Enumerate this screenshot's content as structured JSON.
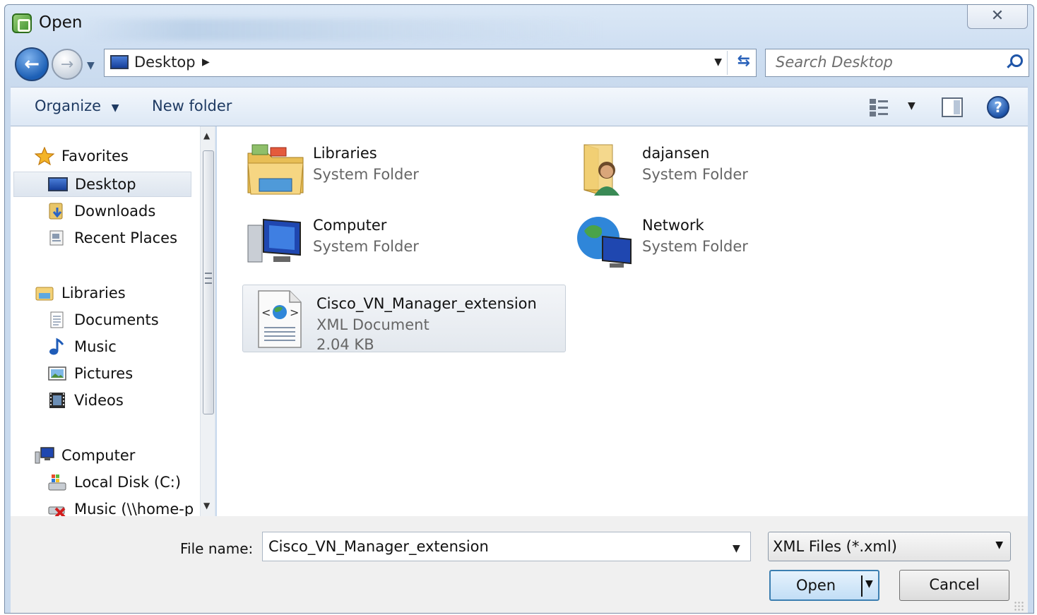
{
  "window": {
    "title": "Open"
  },
  "address": {
    "location": "Desktop"
  },
  "search": {
    "placeholder": "Search Desktop"
  },
  "toolbar": {
    "organize_label": "Organize",
    "new_folder_label": "New folder"
  },
  "sidebar": {
    "favorites": {
      "label": "Favorites",
      "items": [
        {
          "label": "Desktop"
        },
        {
          "label": "Downloads"
        },
        {
          "label": "Recent Places"
        }
      ]
    },
    "libraries": {
      "label": "Libraries",
      "items": [
        {
          "label": "Documents"
        },
        {
          "label": "Music"
        },
        {
          "label": "Pictures"
        },
        {
          "label": "Videos"
        }
      ]
    },
    "computer": {
      "label": "Computer",
      "items": [
        {
          "label": "Local Disk (C:)"
        },
        {
          "label": "Music (\\\\home-p"
        }
      ]
    }
  },
  "files": [
    {
      "name": "Libraries",
      "type": "System Folder"
    },
    {
      "name": "dajansen",
      "type": "System Folder"
    },
    {
      "name": "Computer",
      "type": "System Folder"
    },
    {
      "name": "Network",
      "type": "System Folder"
    },
    {
      "name": "Cisco_VN_Manager_extension",
      "type": "XML Document",
      "size": "2.04 KB"
    }
  ],
  "bottom": {
    "file_name_label": "File name:",
    "file_name_value": "Cisco_VN_Manager_extension",
    "file_type_value": "XML Files (*.xml)",
    "open_label": "Open",
    "cancel_label": "Cancel"
  },
  "icons": {
    "close": "close-icon",
    "back": "back-arrow-icon",
    "forward": "forward-arrow-icon",
    "refresh": "refresh-icon",
    "search": "search-icon",
    "help": "help-icon"
  }
}
